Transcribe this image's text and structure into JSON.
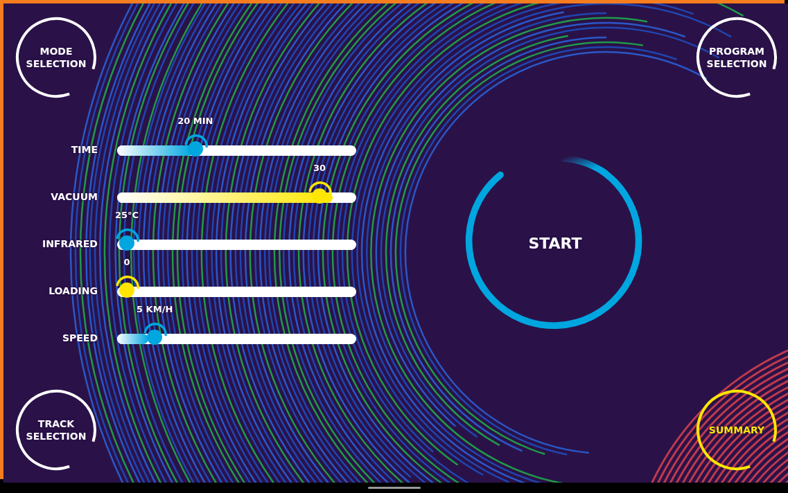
{
  "top_buttons": [
    {
      "label": "MODE SELECTION",
      "color": "#ffffff"
    },
    {
      "label": "PROGRAM SELECTION",
      "color": "#ffffff"
    }
  ],
  "sliders": [
    {
      "label": "TIME",
      "reading": "20 MIN",
      "level": 0.32,
      "color": "#00a6e0"
    },
    {
      "label": "VACUUM",
      "reading": "30",
      "level": 0.9,
      "color": "#ffe600"
    },
    {
      "label": "INFRARED",
      "reading": "25°C",
      "level": 0,
      "color": "#00a6e0"
    },
    {
      "label": "LOADING",
      "reading": "0",
      "level": 0,
      "color": "#ffe600"
    },
    {
      "label": "SPEED",
      "reading": "5 KM/H",
      "level": 0.13,
      "color": "#00a6e0"
    }
  ],
  "start_button": {
    "label": "START"
  },
  "bottom_buttons": [
    {
      "label": "TRACK SELECTION",
      "color": "#ffffff"
    },
    {
      "label": "SUMMARY",
      "color": "#ffe600"
    }
  ]
}
